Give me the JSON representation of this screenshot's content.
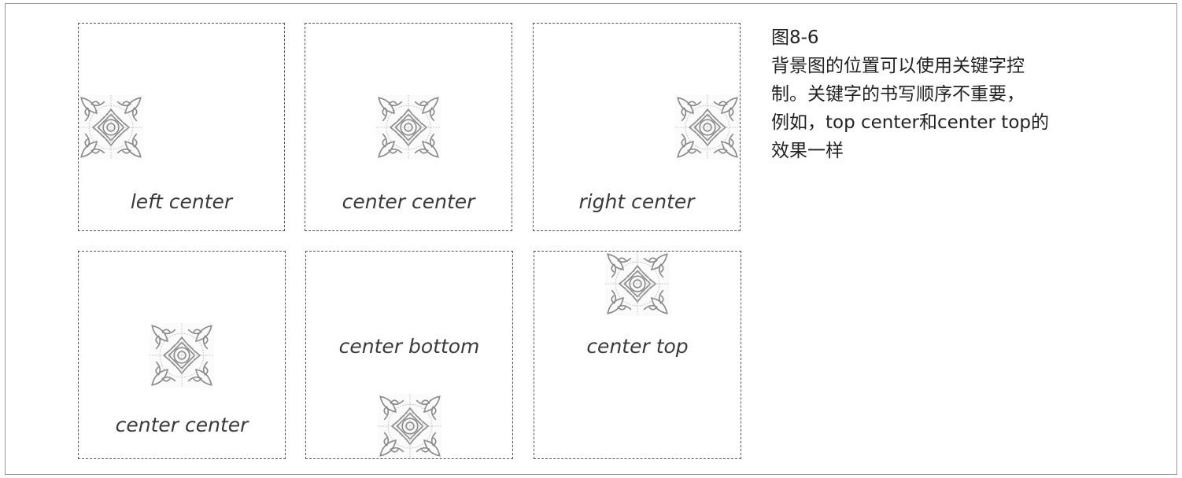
{
  "figure": {
    "number": "图8-6",
    "text_lines": [
      "背景图的位置可以使用关键字控",
      "制。关键字的书写顺序不重要，",
      "例如，top center和center top的",
      "效果一样"
    ]
  },
  "boxes": [
    {
      "label": "left center"
    },
    {
      "label": "center center"
    },
    {
      "label": "right center"
    },
    {
      "label": "center center"
    },
    {
      "label": "center bottom"
    },
    {
      "label": "center top"
    }
  ],
  "colors": {
    "border": "#555555",
    "pattern": "#8a8a8a",
    "text": "#3a3a3a"
  },
  "icons": {
    "pattern_tile": "ornament-tile-icon"
  }
}
